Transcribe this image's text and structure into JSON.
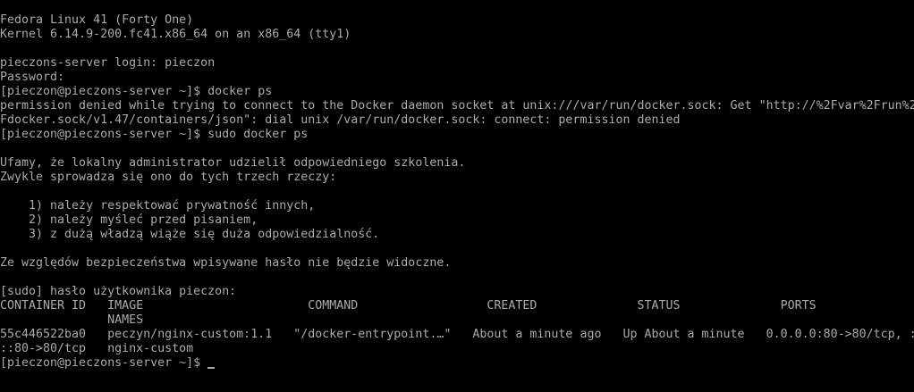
{
  "terminal": {
    "lines": [
      "Fedora Linux 41 (Forty One)",
      "Kernel 6.14.9-200.fc41.x86_64 on an x86_64 (tty1)",
      "",
      "pieczons-server login: pieczon",
      "Password:",
      "[pieczon@pieczons-server ~]$ docker ps",
      "permission denied while trying to connect to the Docker daemon socket at unix:///var/run/docker.sock: Get \"http://%2Fvar%2Frun%2",
      "Fdocker.sock/v1.47/containers/json\": dial unix /var/run/docker.sock: connect: permission denied",
      "[pieczon@pieczons-server ~]$ sudo docker ps",
      "",
      "Ufamy, że lokalny administrator udzielił odpowiedniego szkolenia.",
      "Zwykle sprowadza się ono do tych trzech rzeczy:",
      "",
      "    1) należy respektować prywatność innych,",
      "    2) należy myśleć przed pisaniem,",
      "    3) z dużą władzą wiąże się duża odpowiedzialność.",
      "",
      "Ze względów bezpieczeństwa wpisywane hasło nie będzie widoczne.",
      "",
      "[sudo] hasło użytkownika pieczon:",
      "CONTAINER ID   IMAGE                       COMMAND                  CREATED              STATUS              PORTS",
      "               NAMES",
      "55c446522ba0   peczyn/nginx-custom:1.1   \"/docker-entrypoint.…\"   About a minute ago   Up About a minute   0.0.0.0:80->80/tcp, :",
      "::80->80/tcp   nginx-custom"
    ],
    "prompt": "[pieczon@pieczons-server ~]$ "
  }
}
